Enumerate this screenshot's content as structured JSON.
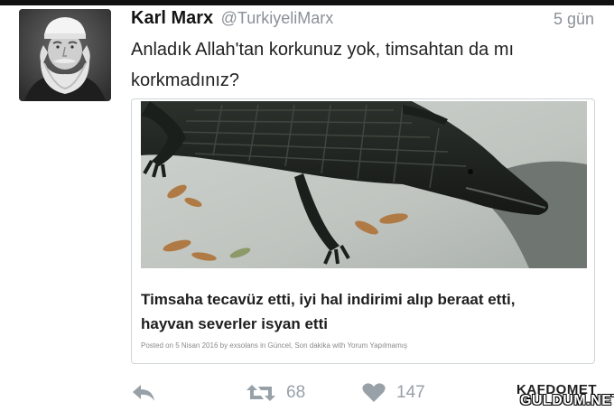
{
  "tweet": {
    "author_name": "Karl Marx",
    "author_handle": "@TurkiyeliMarx",
    "timestamp": "5 gün",
    "text_line1": "Anladık Allah'tan korkunuz yok, timsahtan da mı",
    "text_line2": "korkmadınız?"
  },
  "card": {
    "image_subject": "crocodile-photo",
    "title_line1": "Timsaha tecavüz etti, iyi hal indirimi alıp beraat etti,",
    "title_line2": "hayvan severler isyan etti",
    "meta": "Posted on 5 Nisan 2016 by exsolans in Güncel, Son dakika with Yorum Yapılmamış"
  },
  "actions": {
    "reply_icon": "reply-icon",
    "retweet_icon": "retweet-icon",
    "like_icon": "heart-icon",
    "retweet_count": "68",
    "like_count": "147"
  },
  "watermark": {
    "top_text": "KAFDOMET",
    "main_text": "GULDUM.NET"
  },
  "colors": {
    "text": "#222222",
    "muted": "#8a9096",
    "icon": "#98a0a8",
    "border": "#cfd4d8"
  }
}
